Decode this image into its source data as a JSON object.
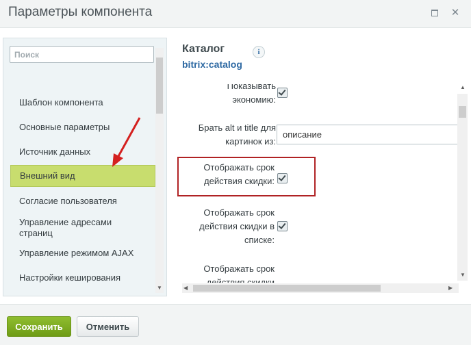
{
  "window": {
    "title": "Параметры компонента",
    "maximize_icon": "maximize-icon",
    "close_icon": "close-icon"
  },
  "sidebar": {
    "search_placeholder": "Поиск",
    "items": [
      {
        "label": "Шаблон компонента"
      },
      {
        "label": "Основные параметры"
      },
      {
        "label": "Источник данных"
      },
      {
        "label": "Внешний вид",
        "active": true
      },
      {
        "label": "Согласие пользователя"
      },
      {
        "label": "Управление адресами страниц"
      },
      {
        "label": "Управление режимом AJAX"
      },
      {
        "label": "Настройки кеширования"
      }
    ]
  },
  "panel": {
    "title": "Каталог",
    "subtitle": "bitrix:catalog",
    "info_icon": "i"
  },
  "settings": [
    {
      "label_line1": "Показывать",
      "label_line2": "экономию:",
      "type": "checkbox",
      "checked": true
    },
    {
      "label_line1": "Брать alt и title для",
      "label_line2": "картинок из:",
      "type": "text",
      "value": "описание"
    },
    {
      "label_line1": "Отображать срок",
      "label_line2": "действия скидки:",
      "type": "checkbox",
      "checked": true
    },
    {
      "label_line1": "Отображать срок",
      "label_line2": "действия скидки в",
      "label_line3": "списке:",
      "type": "checkbox",
      "checked": true
    },
    {
      "label_line1": "Отображать срок",
      "label_line2": "действия скидки",
      "type": "checkbox"
    }
  ],
  "footer": {
    "save_label": "Сохранить",
    "cancel_label": "Отменить"
  },
  "colors": {
    "accent_green": "#7aa71e",
    "active_item": "#c8dd6e",
    "highlight_border": "#b02224",
    "link_blue": "#2f6aa3"
  }
}
